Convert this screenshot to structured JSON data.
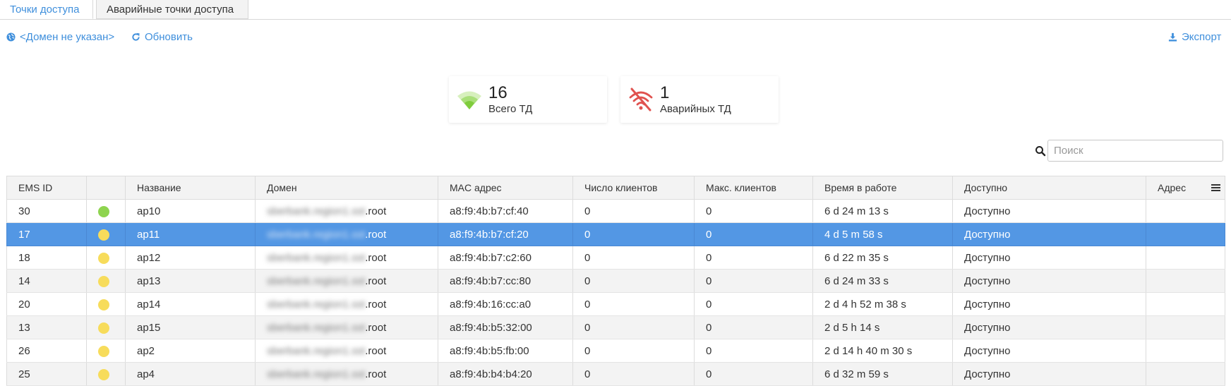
{
  "tabs": [
    {
      "label": "Точки доступа",
      "active": true
    },
    {
      "label": "Аварийные точки доступа",
      "active": false
    }
  ],
  "toolbar": {
    "domain_label": "<Домен не указан>",
    "refresh_label": "Обновить",
    "export_label": "Экспорт"
  },
  "stats": {
    "total": {
      "value": "16",
      "label": "Всего ТД",
      "icon": "wifi-icon"
    },
    "alarm": {
      "value": "1",
      "label": "Аварийных ТД",
      "icon": "wifi-off-icon"
    }
  },
  "search": {
    "placeholder": "Поиск"
  },
  "table": {
    "columns": [
      "EMS ID",
      "",
      "Название",
      "Домен",
      "MAC адрес",
      "Число клиентов",
      "Макс. клиентов",
      "Время в работе",
      "Доступно",
      "Адрес"
    ],
    "rows": [
      {
        "ems_id": "30",
        "status": "green",
        "name": "ap10",
        "domain_masked": "sberbank.region1.sst",
        "domain_suffix": ".root",
        "mac": "a8:f9:4b:b7:cf:40",
        "clients": "0",
        "max_clients": "0",
        "uptime": "6 d 24 m 13 s",
        "available": "Доступно",
        "address": ""
      },
      {
        "ems_id": "17",
        "status": "yellow",
        "name": "ap11",
        "domain_masked": "sberbank.region1.sst",
        "domain_suffix": ".root",
        "mac": "a8:f9:4b:b7:cf:20",
        "clients": "0",
        "max_clients": "0",
        "uptime": "4 d 5 m 58 s",
        "available": "Доступно",
        "address": "",
        "selected": true
      },
      {
        "ems_id": "18",
        "status": "yellow",
        "name": "ap12",
        "domain_masked": "sberbank.region1.sst",
        "domain_suffix": ".root",
        "mac": "a8:f9:4b:b7:c2:60",
        "clients": "0",
        "max_clients": "0",
        "uptime": "6 d 22 m 35 s",
        "available": "Доступно",
        "address": ""
      },
      {
        "ems_id": "14",
        "status": "yellow",
        "name": "ap13",
        "domain_masked": "sberbank.region1.sst",
        "domain_suffix": ".root",
        "mac": "a8:f9:4b:b7:cc:80",
        "clients": "0",
        "max_clients": "0",
        "uptime": "6 d 24 m 33 s",
        "available": "Доступно",
        "address": ""
      },
      {
        "ems_id": "20",
        "status": "yellow",
        "name": "ap14",
        "domain_masked": "sberbank.region1.sst",
        "domain_suffix": ".root",
        "mac": "a8:f9:4b:16:cc:a0",
        "clients": "0",
        "max_clients": "0",
        "uptime": "2 d 4 h 52 m 38 s",
        "available": "Доступно",
        "address": ""
      },
      {
        "ems_id": "13",
        "status": "yellow",
        "name": "ap15",
        "domain_masked": "sberbank.region1.sst",
        "domain_suffix": ".root",
        "mac": "a8:f9:4b:b5:32:00",
        "clients": "0",
        "max_clients": "0",
        "uptime": "2 d 5 h 14 s",
        "available": "Доступно",
        "address": ""
      },
      {
        "ems_id": "26",
        "status": "yellow",
        "name": "ap2",
        "domain_masked": "sberbank.region1.sst",
        "domain_suffix": ".root",
        "mac": "a8:f9:4b:b5:fb:00",
        "clients": "0",
        "max_clients": "0",
        "uptime": "2 d 14 h 40 m 30 s",
        "available": "Доступно",
        "address": ""
      },
      {
        "ems_id": "25",
        "status": "yellow",
        "name": "ap4",
        "domain_masked": "sberbank.region1.sst",
        "domain_suffix": ".root",
        "mac": "a8:f9:4b:b4:b4:20",
        "clients": "0",
        "max_clients": "0",
        "uptime": "6 d 32 m 59 s",
        "available": "Доступно",
        "address": ""
      }
    ]
  },
  "colors": {
    "accent": "#3f8fdc",
    "selected_row": "#5397e4",
    "status_green": "#8ed44f",
    "status_yellow": "#f7dc5b",
    "alarm_red": "#e0524f"
  }
}
